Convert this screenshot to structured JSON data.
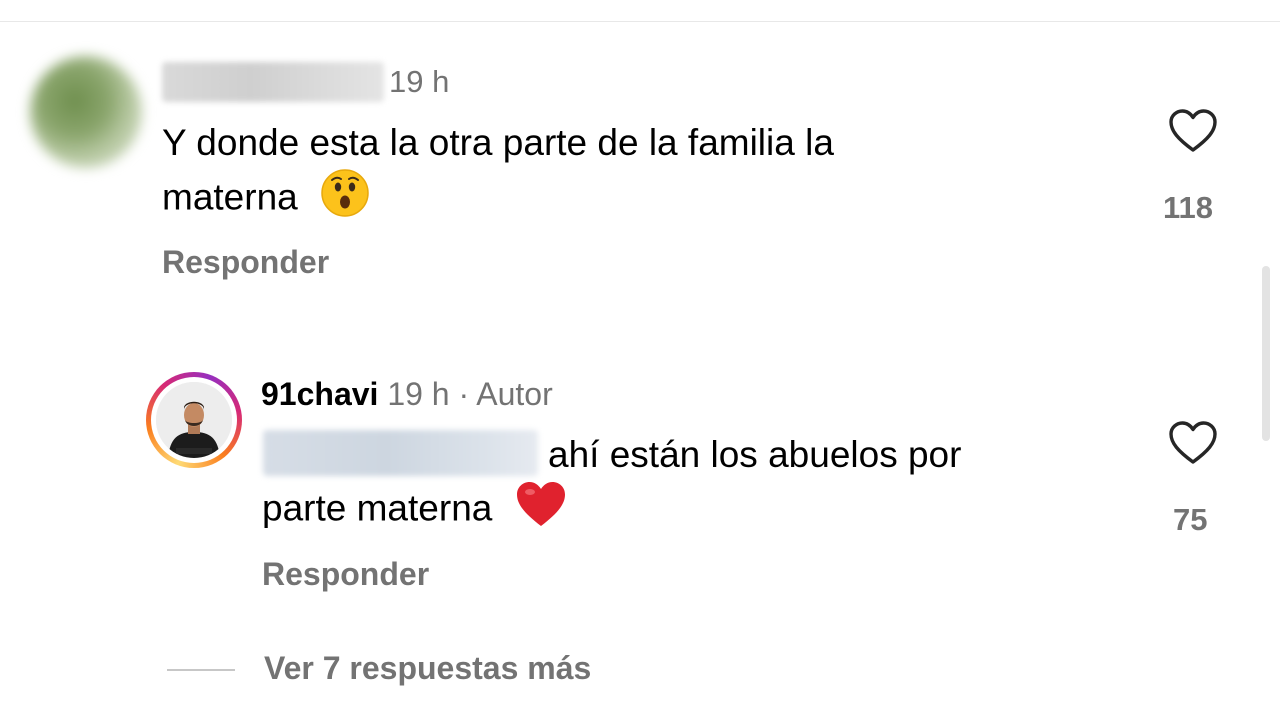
{
  "comments": [
    {
      "time": "19 h",
      "text_line1": "Y donde esta la otra parte de la familia la",
      "text_line2": "materna",
      "emoji": "astonished-face",
      "reply_label": "Responder",
      "like_count": "118"
    },
    {
      "username": "91chavi",
      "meta": "19 h · Autor",
      "text_line1": "ahí están los abuelos por",
      "text_line2": "parte materna",
      "emoji": "red-heart",
      "reply_label": "Responder",
      "like_count": "75"
    }
  ],
  "view_more": "Ver 7 respuestas más",
  "colors": {
    "secondary_text": "#737373",
    "story_ring": [
      "#feda75",
      "#fa7e1e",
      "#d62976",
      "#962fbf"
    ]
  }
}
